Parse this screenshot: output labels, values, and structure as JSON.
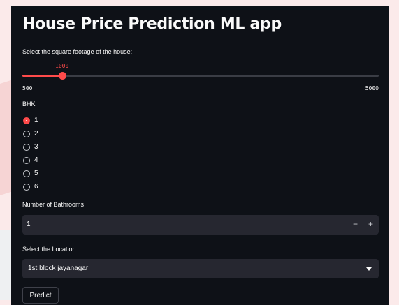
{
  "app": {
    "title": "House Price Prediction ML app"
  },
  "sqft_slider": {
    "label": "Select the square footage of the house:",
    "value": 1000,
    "value_label": "1000",
    "min": 500,
    "max": 5000,
    "min_label": "500",
    "max_label": "5000"
  },
  "bhk": {
    "label": "BHK",
    "options": [
      "1",
      "2",
      "3",
      "4",
      "5",
      "6"
    ],
    "selected": "1"
  },
  "bathrooms": {
    "label": "Number of Bathrooms",
    "value": "1",
    "minus_label": "−",
    "plus_label": "+"
  },
  "location": {
    "label": "Select the Location",
    "value": "1st block jayanagar"
  },
  "predict": {
    "label": "Predict"
  },
  "colors": {
    "accent": "#ff4b4b",
    "background": "#0e1117",
    "input_bg": "#262730",
    "text": "#fafafa"
  }
}
